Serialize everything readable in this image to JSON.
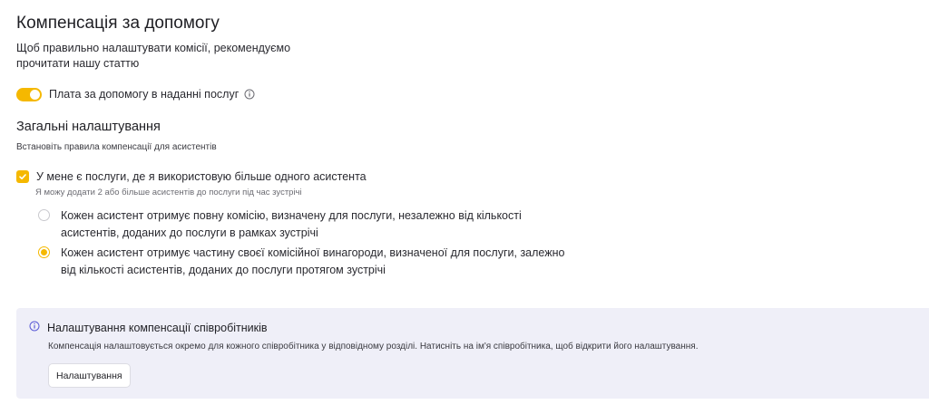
{
  "header": {
    "title": "Компенсація за допомогу",
    "intro": "Щоб правильно налаштувати комісії, рекомендуємо прочитати нашу статтю"
  },
  "toggle": {
    "label": "Плата за допомогу в наданні послуг",
    "enabled": true
  },
  "general": {
    "title": "Загальні налаштування",
    "subtitle": "Встановіть правила компенсації для асистентів",
    "multi_assistant": {
      "label": "У мене є послуги, де я використовую більше одного асистента",
      "hint": "Я можу додати 2 або більше асистентів до послуги під час зустрічі",
      "checked": true
    },
    "options": [
      {
        "label": "Кожен асистент отримує повну комісію, визначену для послуги, незалежно від кількості асистентів, доданих до послуги в рамках зустрічі",
        "selected": false
      },
      {
        "label": "Кожен асистент отримує частину своєї комісійної винагороди, визначеної для послуги, залежно від кількості асистентів, доданих до послуги протягом зустрічі",
        "selected": true
      }
    ]
  },
  "info_box": {
    "title": "Налаштування компенсації співробітників",
    "text": "Компенсація налаштовується окремо для кожного співробітника у відповідному розділі. Натисніть на ім'я співробітника, щоб відкрити його налаштування.",
    "button_label": "Налаштування"
  },
  "colors": {
    "accent": "#f5b800",
    "info_bg": "#efeff8",
    "info_icon": "#5b5bd6"
  }
}
